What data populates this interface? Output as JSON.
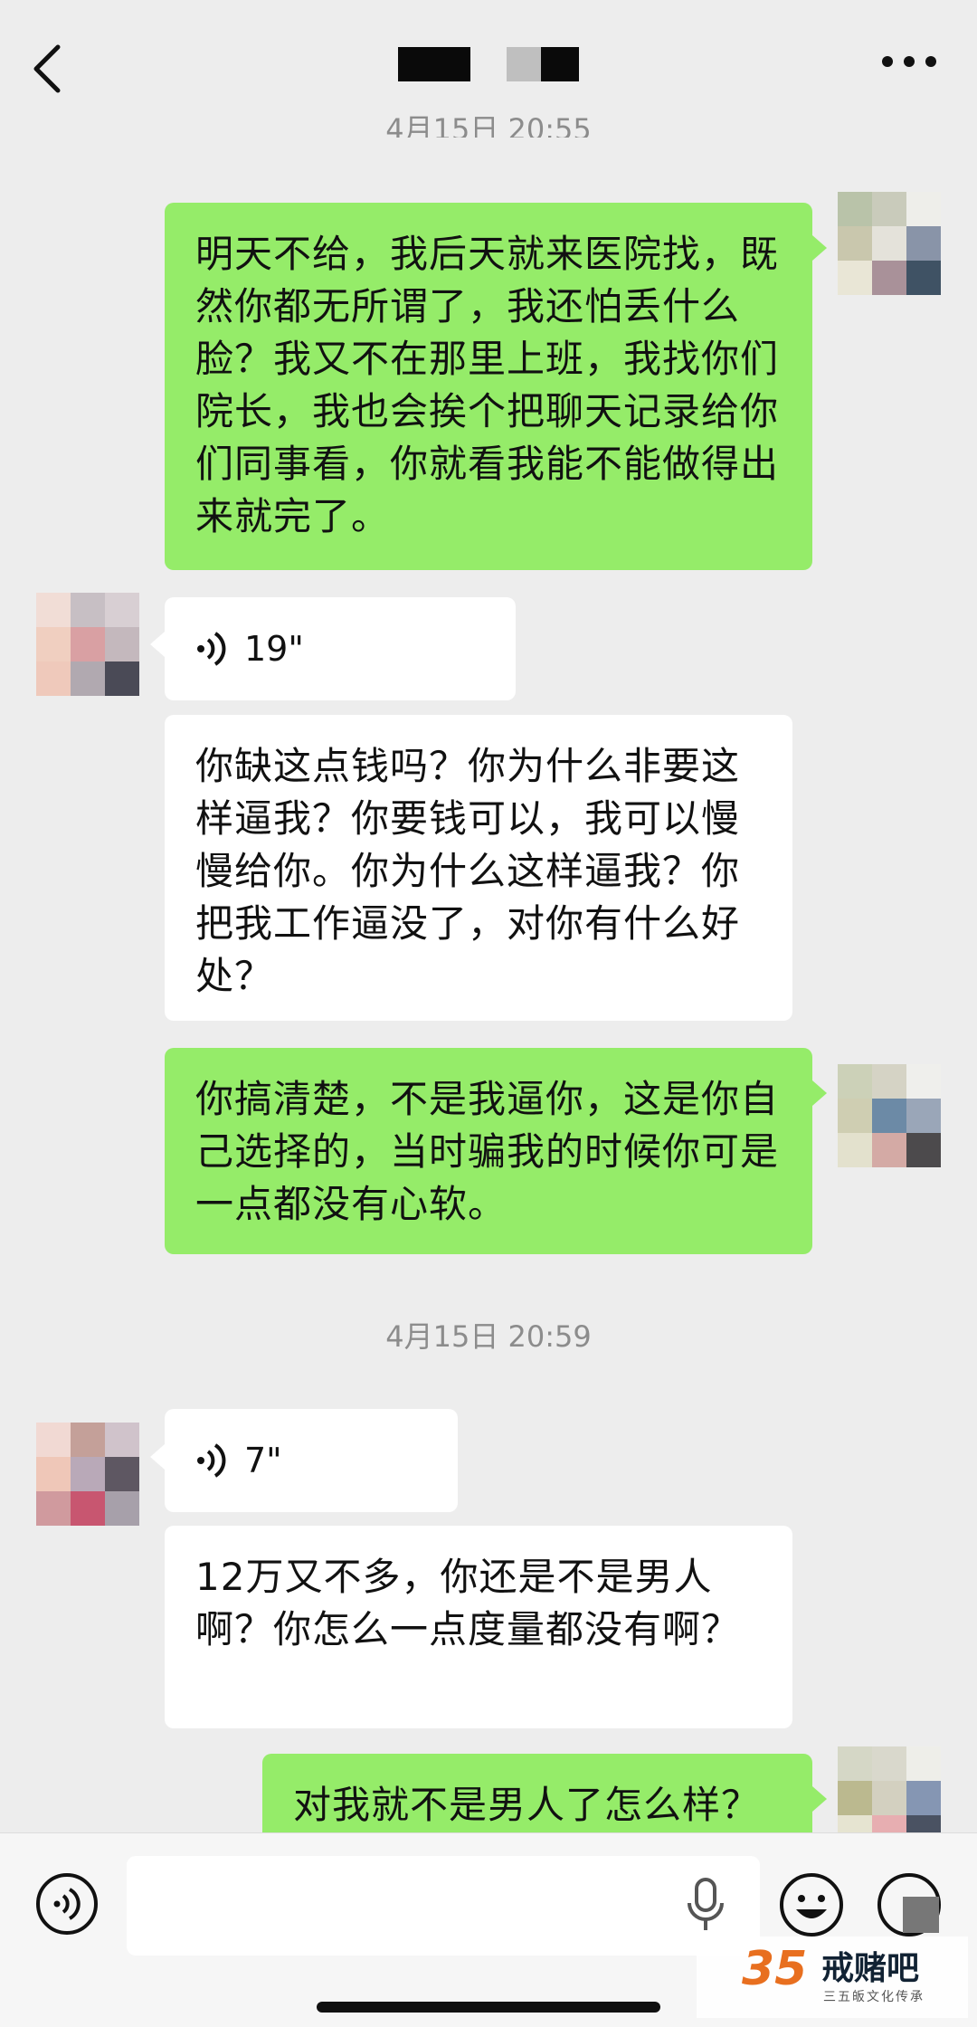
{
  "header": {
    "back_icon": "chevron-left-icon",
    "more_icon": "more-dots-icon"
  },
  "timestamps": [
    "4月15日 20:55",
    "4月15日 20:59"
  ],
  "messages": [
    {
      "from": "me",
      "type": "text",
      "text": "明天不给，我后天就来医院找，既然你都无所谓了，我还怕丢什么脸？我又不在那里上班，我找你们院长，我也会挨个把聊天记录给你们同事看，你就看我能不能做得出来就完了。"
    },
    {
      "from": "other",
      "type": "voice",
      "duration": "19\""
    },
    {
      "from": "other",
      "type": "text",
      "text": "你缺这点钱吗？你为什么非要这样逼我？你要钱可以，我可以慢慢给你。你为什么这样逼我？你把我工作逼没了，对你有什么好处？"
    },
    {
      "from": "me",
      "type": "text",
      "text": "你搞清楚，不是我逼你，这是你自己选择的，当时骗我的时候你可是一点都没有心软。"
    },
    {
      "from": "other",
      "type": "voice",
      "duration": "7\""
    },
    {
      "from": "other",
      "type": "text",
      "text": "12万又不多，你还是不是男人啊？你怎么一点度量都没有啊？"
    },
    {
      "from": "me",
      "type": "text",
      "text": "对我就不是男人了怎么样？"
    }
  ],
  "input_bar": {
    "voice_icon": "voice-mode-icon",
    "mic_icon": "microphone-icon",
    "emoji_icon": "emoji-icon",
    "plus_icon": "plus-icon",
    "placeholder": ""
  },
  "watermark": {
    "number": "35",
    "name": "戒赌吧",
    "subtitle": "三五皈文化传承"
  },
  "colors": {
    "background": "#ededed",
    "my_bubble": "#95ec69",
    "other_bubble": "#ffffff",
    "timestamp": "#8c8c8c"
  }
}
